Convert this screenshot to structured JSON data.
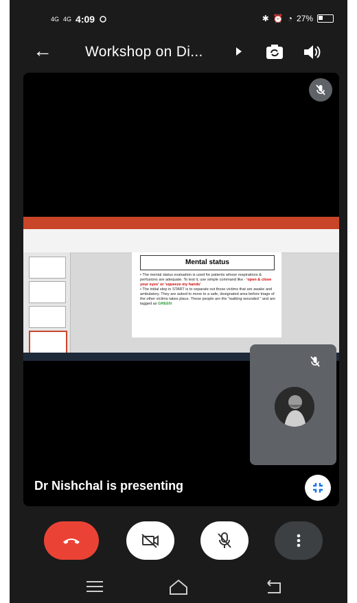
{
  "status_bar": {
    "signal1": "4G",
    "signal2": "4G",
    "time": "4:09",
    "battery": "27%"
  },
  "toolbar": {
    "title": "Workshop on Di...",
    "back_icon": "arrow-left-icon",
    "cast_icon": "play-triangle-icon",
    "switch_camera_icon": "switch-camera-icon",
    "speaker_icon": "speaker-icon"
  },
  "slide": {
    "title": "Mental status",
    "bullet1_a": "The mental status evaluation is used for patients whose respirations & perfusions are adequate. To test it, use simple command like - ",
    "bullet1_b": "'open & close your eyes' or 'squeeze my hands'",
    "bullet2_a": "The initial step in START is to separate out those victims that are awake and ambulatory. They are asked to move to a safe, designated area before triage of the other victims takes place. These people are the \"walking wounded \" and are tagged as ",
    "bullet2_b": "GREEN"
  },
  "presenting_label": "Dr Nishchal is presenting",
  "controls": {
    "end_call_icon": "end-call-icon",
    "camera_off_icon": "camera-off-icon",
    "mic_off_icon": "mic-off-icon",
    "more_icon": "more-vertical-icon"
  },
  "colors": {
    "end_call": "#ea4335",
    "control_bg": "#ffffff",
    "more_bg": "#3c4043",
    "tile_bg": "#5f6368"
  }
}
